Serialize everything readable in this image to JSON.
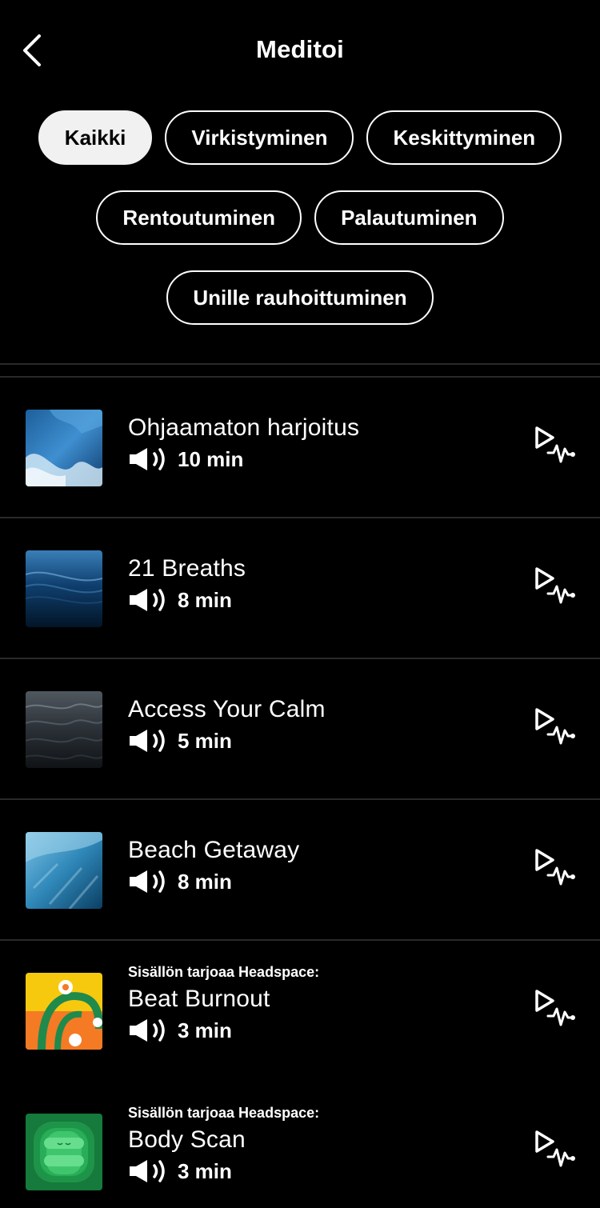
{
  "header": {
    "title": "Meditoi"
  },
  "filters": [
    [
      "Kaikki",
      "Virkistyminen",
      "Keskittyminen"
    ],
    [
      "Rentoutuminen",
      "Palautuminen"
    ],
    [
      "Unille rauhoittuminen"
    ]
  ],
  "active_filter": "Kaikki",
  "items": [
    {
      "provider": "",
      "title": "Ohjaamaton harjoitus",
      "duration": "10 min",
      "thumb": "wave-blue"
    },
    {
      "provider": "",
      "title": "21 Breaths",
      "duration": "8 min",
      "thumb": "ocean-dark"
    },
    {
      "provider": "",
      "title": "Access Your Calm",
      "duration": "5 min",
      "thumb": "water-grey"
    },
    {
      "provider": "",
      "title": "Beach Getaway",
      "duration": "8 min",
      "thumb": "underwater"
    },
    {
      "provider": "Sisällön tarjoaa Headspace:",
      "title": "Beat Burnout",
      "duration": "3 min",
      "thumb": "headspace-yellow"
    },
    {
      "provider": "Sisällön tarjoaa Headspace:",
      "title": "Body Scan",
      "duration": "3 min",
      "thumb": "headspace-green"
    }
  ],
  "colors": {
    "background": "#000000",
    "text": "#ffffff",
    "chip_active_bg": "#f1f1f1",
    "divider": "#2a2a2a"
  },
  "icons": {
    "back": "chevron-left-icon",
    "audio": "speaker-icon",
    "play": "play-heartbeat-icon"
  }
}
